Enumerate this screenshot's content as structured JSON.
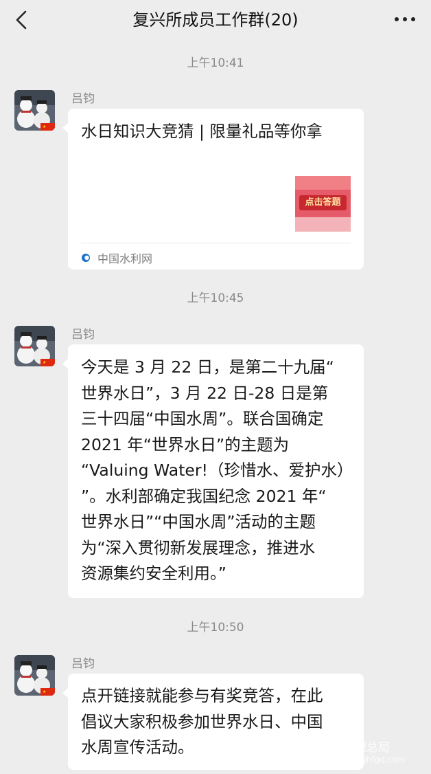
{
  "header": {
    "title": "复兴所成员工作群(20)",
    "back_icon": "chevron-left-icon",
    "more_icon": "ellipsis-icon"
  },
  "messages": [
    {
      "time": "上午10:41",
      "sender": "吕钧",
      "type": "link-card",
      "card_title": "水日知识大竞猜 | 限量礼品等你拿",
      "thumb_text": "点击答题",
      "source": "中国水利网"
    },
    {
      "time": "上午10:45",
      "sender": "吕钧",
      "type": "text",
      "text": "今天是 3 月 22 日，是第二十九届“\n世界水日”，3 月 22 日-28 日是第\n三十四届“中国水周”。联合国确定\n2021 年“世界水日”的主题为\n“Valuing Water!（珍惜水、爱护水）\n”。水利部确定我国纪念 2021 年“\n世界水日”“中国水周”活动的主题\n为“深入贯彻新发展理念，推进水\n资源集约安全利用。”"
    },
    {
      "time": "上午10:50",
      "sender": "吕钧",
      "type": "text",
      "text": "点开链接就能参与有奖竞答，在此\n倡议大家积极参加世界水日、中国\n水周宣传活动。"
    }
  ],
  "watermark": {
    "text": "管理总局",
    "sub": "zghfgq.com"
  },
  "colors": {
    "background": "#ededed",
    "bubble": "#ffffff",
    "muted_text": "#8a8a8a",
    "thumb_red": "#d62f3f"
  }
}
